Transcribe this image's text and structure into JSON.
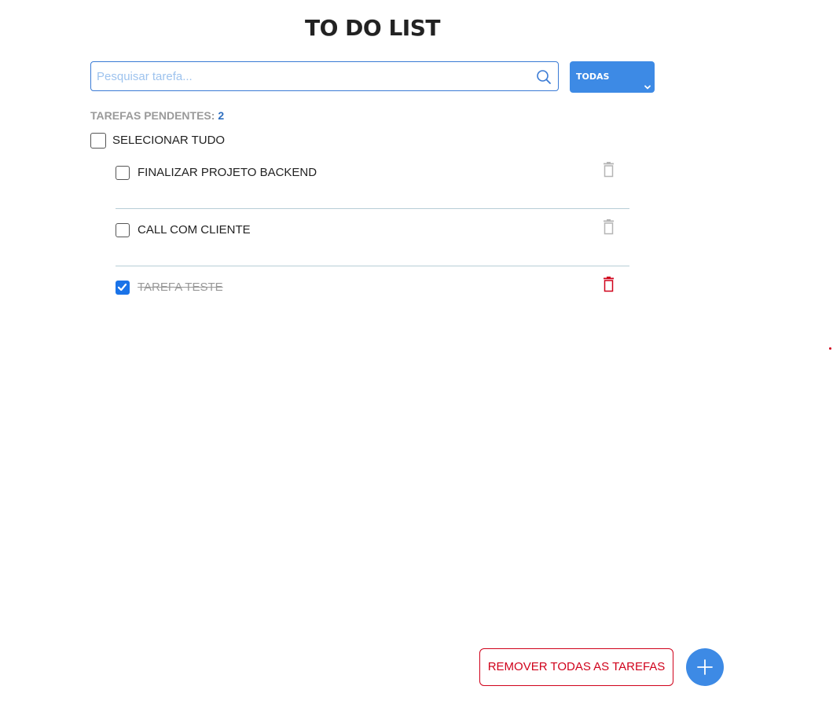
{
  "header": {
    "title": "TO DO LIST"
  },
  "search": {
    "placeholder": "Pesquisar tarefa...",
    "value": "",
    "icon": "search-icon"
  },
  "filter": {
    "selected": "TODAS",
    "icon": "chevron-down-icon",
    "background_color": "#3d8ae5"
  },
  "summary": {
    "pending_label": "TAREFAS PENDENTES:",
    "pending_count": "2"
  },
  "select_all": {
    "label": "SELECIONAR TUDO",
    "checked": false
  },
  "tasks": [
    {
      "label": "FINALIZAR PROJETO BACKEND",
      "checked": false,
      "delete_icon": "trash-icon",
      "delete_color": "#b5b5b5"
    },
    {
      "label": "CALL COM CLIENTE",
      "checked": false,
      "delete_icon": "trash-icon",
      "delete_color": "#b5b5b5"
    },
    {
      "label": "TAREFA TESTE",
      "checked": true,
      "delete_icon": "trash-icon",
      "delete_color": "#d0021b"
    }
  ],
  "footer": {
    "remove_all_label": "REMOVER TODAS AS TAREFAS",
    "add_icon": "plus-icon",
    "danger_color": "#d0021b",
    "accent_color": "#3d8ae5"
  }
}
